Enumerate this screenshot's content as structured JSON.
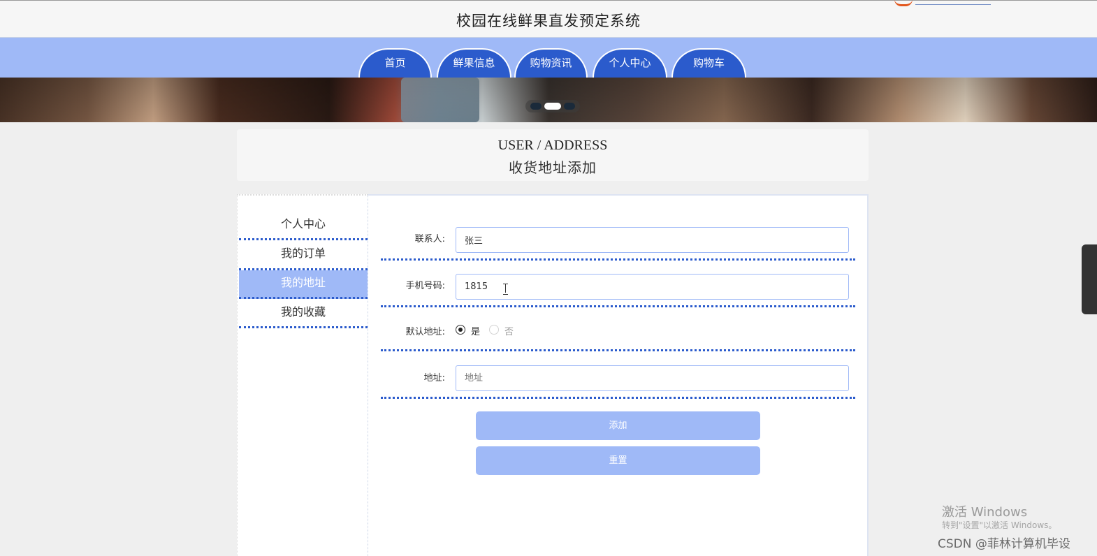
{
  "header": {
    "site_title": "校园在线鲜果直发预定系统"
  },
  "nav": {
    "items": [
      {
        "label": "首页"
      },
      {
        "label": "鲜果信息"
      },
      {
        "label": "购物资讯"
      },
      {
        "label": "个人中心"
      },
      {
        "label": "购物车"
      }
    ]
  },
  "banner": {
    "slide_count": 3,
    "active_slide": 2
  },
  "page_heading": {
    "en": "USER / ADDRESS",
    "cn": "收货地址添加"
  },
  "sidebar": {
    "items": [
      {
        "label": "个人中心",
        "active": false
      },
      {
        "label": "我的订单",
        "active": false
      },
      {
        "label": "我的地址",
        "active": true
      },
      {
        "label": "我的收藏",
        "active": false
      }
    ]
  },
  "form": {
    "contact": {
      "label": "联系人:",
      "value": "张三"
    },
    "phone": {
      "label": "手机号码:",
      "value": "1815"
    },
    "default_address": {
      "label": "默认地址:",
      "option_yes": "是",
      "option_no": "否",
      "selected": "是"
    },
    "address": {
      "label": "地址:",
      "value": "",
      "placeholder": "地址"
    },
    "add_button": "添加",
    "reset_button": "重置"
  },
  "watermark": {
    "activate_title": "激活 Windows",
    "activate_hint": "转到\"设置\"以激活 Windows。",
    "csdn": "CSDN @菲林计算机毕设"
  },
  "colors": {
    "accent": "#2b5bcc",
    "light_accent": "#9fb9f7",
    "background": "#efefef"
  }
}
